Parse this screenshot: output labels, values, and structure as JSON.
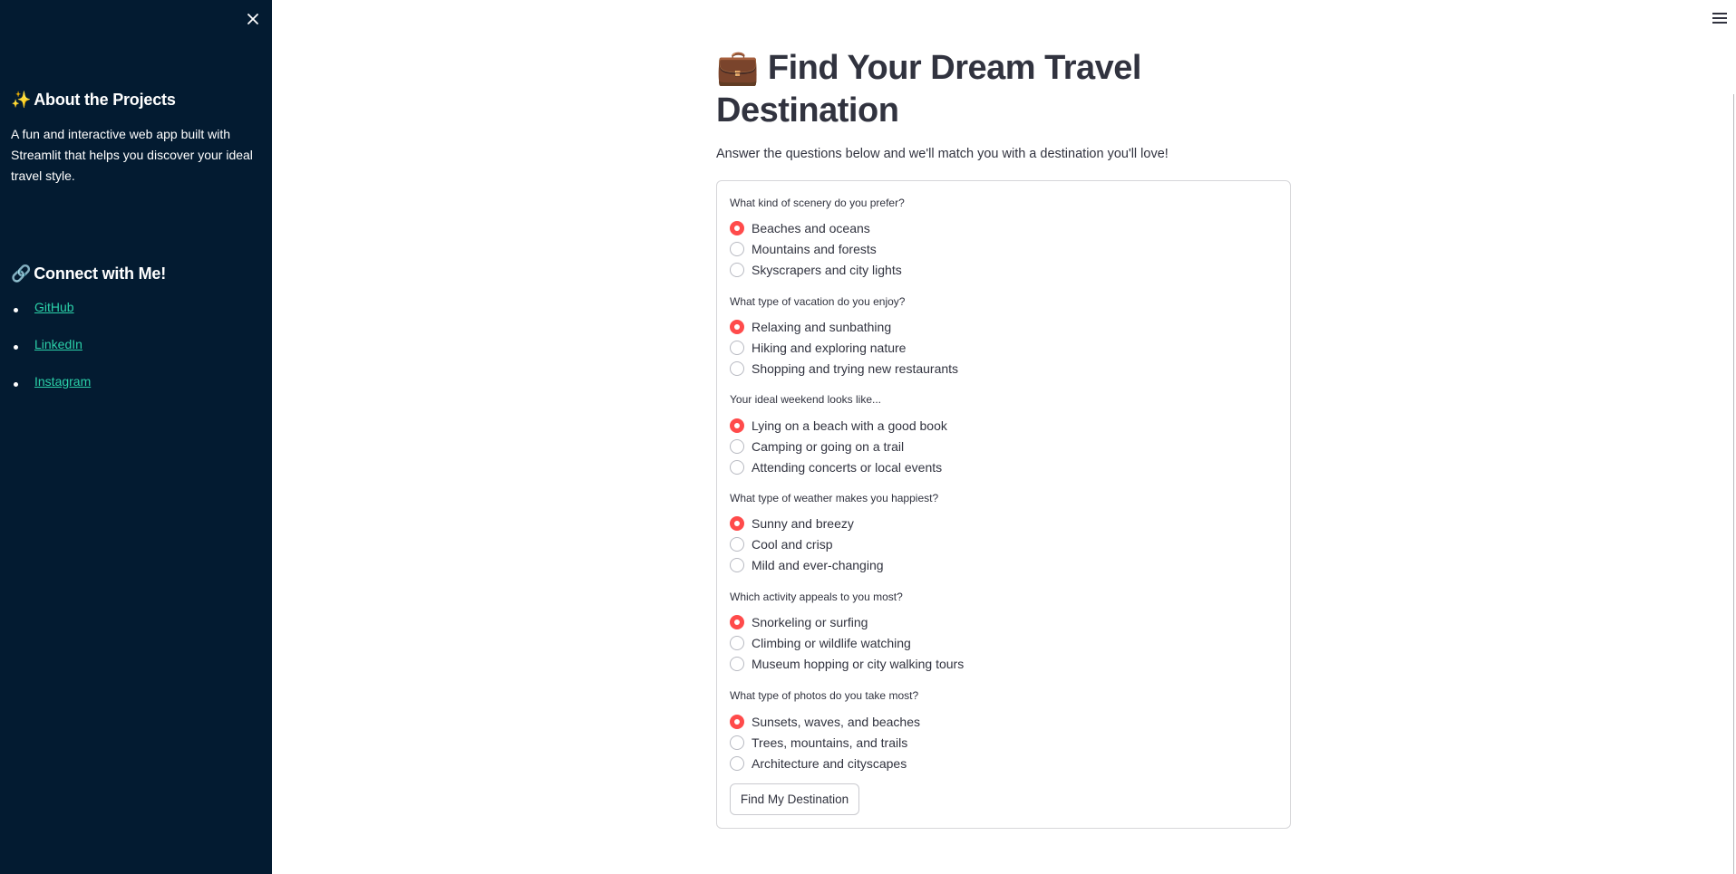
{
  "sidebar": {
    "about_emoji": "✨",
    "about_heading": "About the Projects",
    "about_text": "A fun and interactive web app built with Streamlit that helps you discover your ideal travel style.",
    "connect_emoji": "🔗",
    "connect_heading": "Connect with Me!",
    "links": [
      "GitHub",
      "LinkedIn",
      "Instagram"
    ]
  },
  "icons": {
    "close": "close-icon",
    "menu": "hamburger-menu-icon",
    "title": "briefcase-emoji"
  },
  "colors": {
    "sidebar_bg": "#031b31",
    "link": "#2bd1a9",
    "radio_selected": "#ff4b4b",
    "text": "#31333f"
  },
  "main": {
    "title_emoji": "💼",
    "title": "Find Your Dream Travel Destination",
    "subtitle": "Answer the questions below and we'll match you with a destination you'll love!",
    "questions": [
      {
        "label": "What kind of scenery do you prefer?",
        "options": [
          "Beaches and oceans",
          "Mountains and forests",
          "Skyscrapers and city lights"
        ],
        "selected": "Beaches and oceans"
      },
      {
        "label": "What type of vacation do you enjoy?",
        "options": [
          "Relaxing and sunbathing",
          "Hiking and exploring nature",
          "Shopping and trying new restaurants"
        ],
        "selected": "Relaxing and sunbathing"
      },
      {
        "label": "Your ideal weekend looks like...",
        "options": [
          "Lying on a beach with a good book",
          "Camping or going on a trail",
          "Attending concerts or local events"
        ],
        "selected": "Lying on a beach with a good book"
      },
      {
        "label": "What type of weather makes you happiest?",
        "options": [
          "Sunny and breezy",
          "Cool and crisp",
          "Mild and ever-changing"
        ],
        "selected": "Sunny and breezy"
      },
      {
        "label": "Which activity appeals to you most?",
        "options": [
          "Snorkeling or surfing",
          "Climbing or wildlife watching",
          "Museum hopping or city walking tours"
        ],
        "selected": "Snorkeling or surfing"
      },
      {
        "label": "What type of photos do you take most?",
        "options": [
          "Sunsets, waves, and beaches",
          "Trees, mountains, and trails",
          "Architecture and cityscapes"
        ],
        "selected": "Sunsets, waves, and beaches"
      }
    ],
    "submit_label": "Find My Destination"
  }
}
